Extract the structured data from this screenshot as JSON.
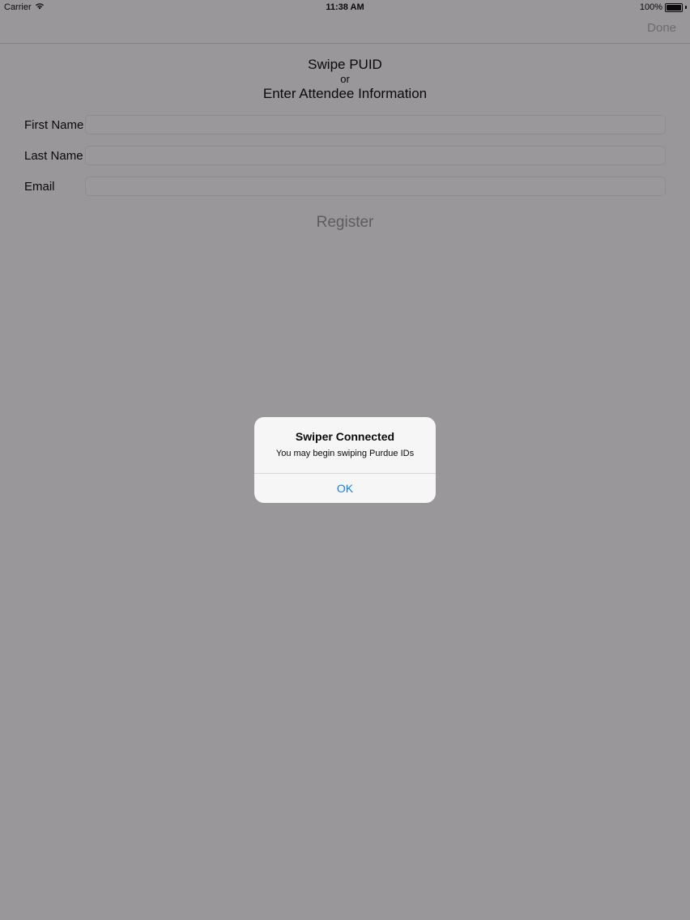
{
  "status_bar": {
    "carrier": "Carrier",
    "time": "11:38 AM",
    "battery": "100%"
  },
  "nav": {
    "done_label": "Done"
  },
  "header": {
    "line1": "Swipe PUID",
    "line2": "or",
    "line3": "Enter Attendee Information"
  },
  "form": {
    "first_name_label": "First Name",
    "first_name_value": "",
    "last_name_label": "Last Name",
    "last_name_value": "",
    "email_label": "Email",
    "email_value": ""
  },
  "register_label": "Register",
  "alert": {
    "title": "Swiper Connected",
    "message": "You may begin swiping Purdue IDs",
    "button_label": "OK"
  },
  "colors": {
    "dim_background": "#99979a",
    "alert_background": "#f6f6f7",
    "alert_button": "#1a7fd6"
  },
  "icons": {
    "wifi": "wifi-icon",
    "battery": "battery-icon"
  }
}
